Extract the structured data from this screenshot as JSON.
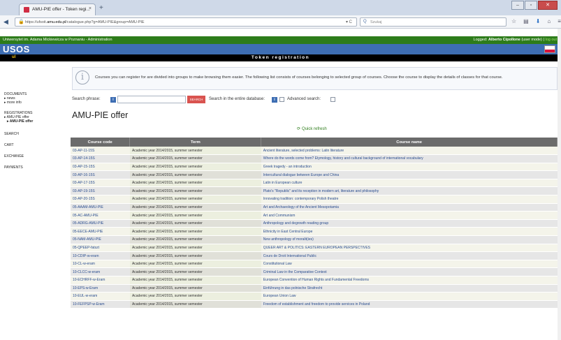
{
  "browser": {
    "tab_title": "AMU-PIE offer - Token regi...",
    "tab_close": "×",
    "new_tab": "+",
    "url_prefix": "https://ufsoit.",
    "url_domain": "amu.edu.pl",
    "url_suffix": "/catalogue.php?g=AMU-PIE&group=AMU-PIE",
    "search_placeholder": "Szukaj",
    "reload": "▾ C"
  },
  "header": {
    "university": "Uniwersytet im. Adama Mickiewicza w Poznaniu - Administration",
    "logged_label": "Logged:",
    "logged_user": "Alberto Cipollone",
    "logged_mode": "(user mode)",
    "logout": "log out",
    "logo": "USOS",
    "logo_sub": "ul",
    "page_title_bar": "Token registration",
    "flag_colors": [
      "#ffffff",
      "#dc143c"
    ]
  },
  "sidebar": {
    "documents": "DOCUMENTS",
    "news": "▸ news",
    "more_info": "▸ more info",
    "registrations": "REGISTRATIONS",
    "amu_pie_offer": "▸ AMU-PIE offer",
    "amu_pie_offer_sub": "▸ AMU-PIE offer",
    "search": "SEARCH",
    "cart": "CART",
    "exchange": "EXCHANGE",
    "payments": "PAYMENTS"
  },
  "info": {
    "icon": "i",
    "text": "Courses you can register for are divided into groups to make browsing them easier. The following list consists of courses belonging to selected group of courses. Choose the course to display the details of classes for that course."
  },
  "search": {
    "phrase_label": "Search phrase:",
    "help": "i",
    "button": "SEARCH",
    "entire_db_label": "Search in the entire database:",
    "advanced_label": "Advanced search:"
  },
  "main": {
    "title": "AMU-PIE offer",
    "quick_refresh": "Quick refresh"
  },
  "table": {
    "headers": [
      "Course code",
      "Term",
      "Course name"
    ],
    "rows": [
      [
        "03-AP-11-15S",
        "Academic year 2014/2015, summer semester",
        "Ancient literature, selected problems: Latin literature"
      ],
      [
        "03-AP-14-15S",
        "Academic year 2014/2015, summer semester",
        "Where do the words come from? Etymology, history and cultural background of international vocabulary"
      ],
      [
        "03-AP-15-15S",
        "Academic year 2014/2015, summer semester",
        "Greek tragedy - an introduction"
      ],
      [
        "03-AP-16-15S",
        "Academic year 2014/2015, summer semester",
        "Intercultural dialogue between Europe and China"
      ],
      [
        "03-AP-17-15S",
        "Academic year 2014/2015, summer semester",
        "Latin in European culture"
      ],
      [
        "03-AP-19-15S",
        "Academic year 2014/2015, summer semester",
        "Plato's \"Republic\" and its reception in modern art, literature and philosophy"
      ],
      [
        "03-AP-20-15S",
        "Academic year 2014/2015, summer semester",
        "Innovating tradition: contemporary Polish theatre"
      ],
      [
        "05-AAAM-AMU-PIE",
        "Academic year 2014/2015, summer semester",
        "Art and Archaeology of the Ancient Mesopotamia"
      ],
      [
        "05-AC-AMU-PIE",
        "Academic year 2014/2015, summer semester",
        "Art and Communism"
      ],
      [
        "05-ADRG-AMU-PIE",
        "Academic year 2014/2015, summer semester",
        "Anthropology and degrowth reading group"
      ],
      [
        "05-EECE-AMU-PIE",
        "Academic year 2014/2015, summer semester",
        "Ethnicity in East Central Europe"
      ],
      [
        "05-NAM-AMU-PIE",
        "Academic year 2014/2015, summer semester",
        "New anthropology of moralit(ies)"
      ],
      [
        "05-QPEEP-fatszt",
        "Academic year 2014/2015, summer semester",
        "QUEER ART & POLITICS: EASTERN EUROPEAN PERSPECTIVES"
      ],
      [
        "10-CDIP-w-eram",
        "Academic year 2014/2015, summer semester",
        "Cours de Droit International Public"
      ],
      [
        "10-CL-w-eram",
        "Academic year 2014/2015, summer semester",
        "Constitutional Law"
      ],
      [
        "10-CLCC-w-eram",
        "Academic year 2014/2015, summer semester",
        "Criminal Law in the Comparative Context"
      ],
      [
        "10-ECHRFF-w-Eram",
        "Academic year 2014/2015, summer semester",
        "European Convention of Human Rights and Fundamental Freedoms"
      ],
      [
        "10-EPS-w-Eram",
        "Academic year 2014/2015, summer semester",
        "Einführung in das polnische Strafrecht"
      ],
      [
        "10-EUL-w-eram",
        "Academic year 2014/2015, summer semester",
        "European Union Law"
      ],
      [
        "10-FEFPSP-w-Eram",
        "Academic year 2014/2015, summer semester",
        "Freedom of establishment and freedom to provide services in Poland"
      ]
    ]
  }
}
